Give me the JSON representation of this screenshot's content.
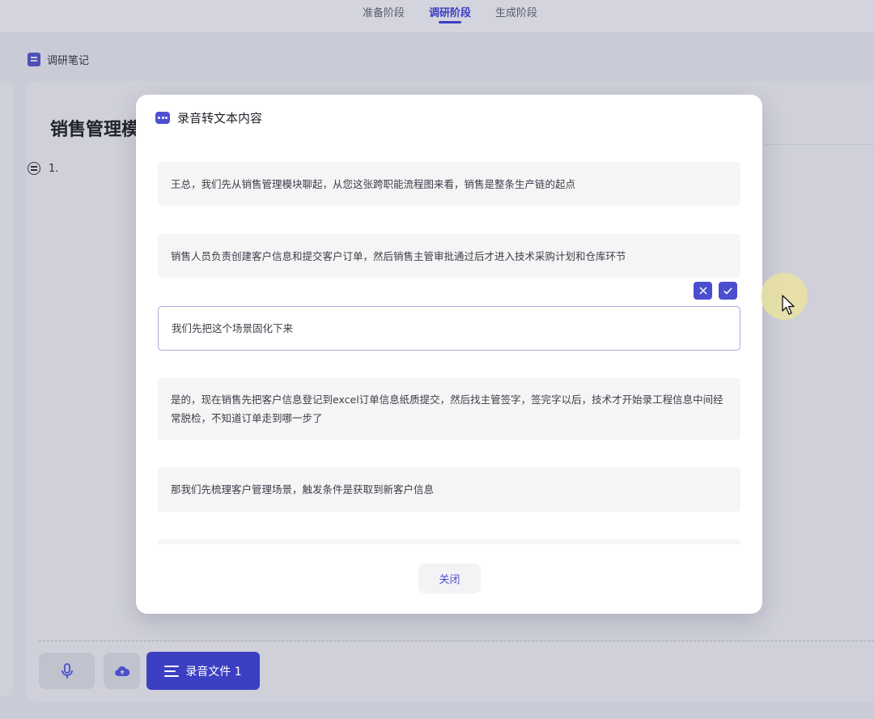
{
  "top_tabs": [
    {
      "label": "准备阶段",
      "active": false
    },
    {
      "label": "调研阶段",
      "active": true
    },
    {
      "label": "生成阶段",
      "active": false
    }
  ],
  "section": {
    "title": "调研笔记",
    "icon": "note-icon"
  },
  "main": {
    "title": "销售管理模",
    "list_number": "1."
  },
  "bottom_bar": {
    "mic_icon": "microphone-icon",
    "upload_icon": "cloud-upload-icon",
    "recording_label": "录音文件 1"
  },
  "modal": {
    "title": "录音转文本内容",
    "entries": [
      {
        "text": "王总，我们先从销售管理模块聊起，从您这张跨职能流程图来看，销售是整条生产链的起点"
      },
      {
        "text": "销售人员负责创建客户信息和提交客户订单，然后销售主管审批通过后才进入技术采购计划和仓库环节"
      },
      {
        "text": "我们先把这个场景固化下来",
        "editing": true
      },
      {
        "text": "是的，现在销售先把客户信息登记到excel订单信息纸质提交，然后找主管签字，签完字以后，技术才开始录工程信息中间经常脱检，不知道订单走到哪一步了"
      },
      {
        "text": "那我们先梳理客户管理场景，触发条件是获取到新客户信息"
      },
      {
        "text": ""
      }
    ],
    "close_label": "关闭"
  },
  "colors": {
    "accent": "#4b4ecf",
    "active_tab": "#3b3fc4"
  }
}
